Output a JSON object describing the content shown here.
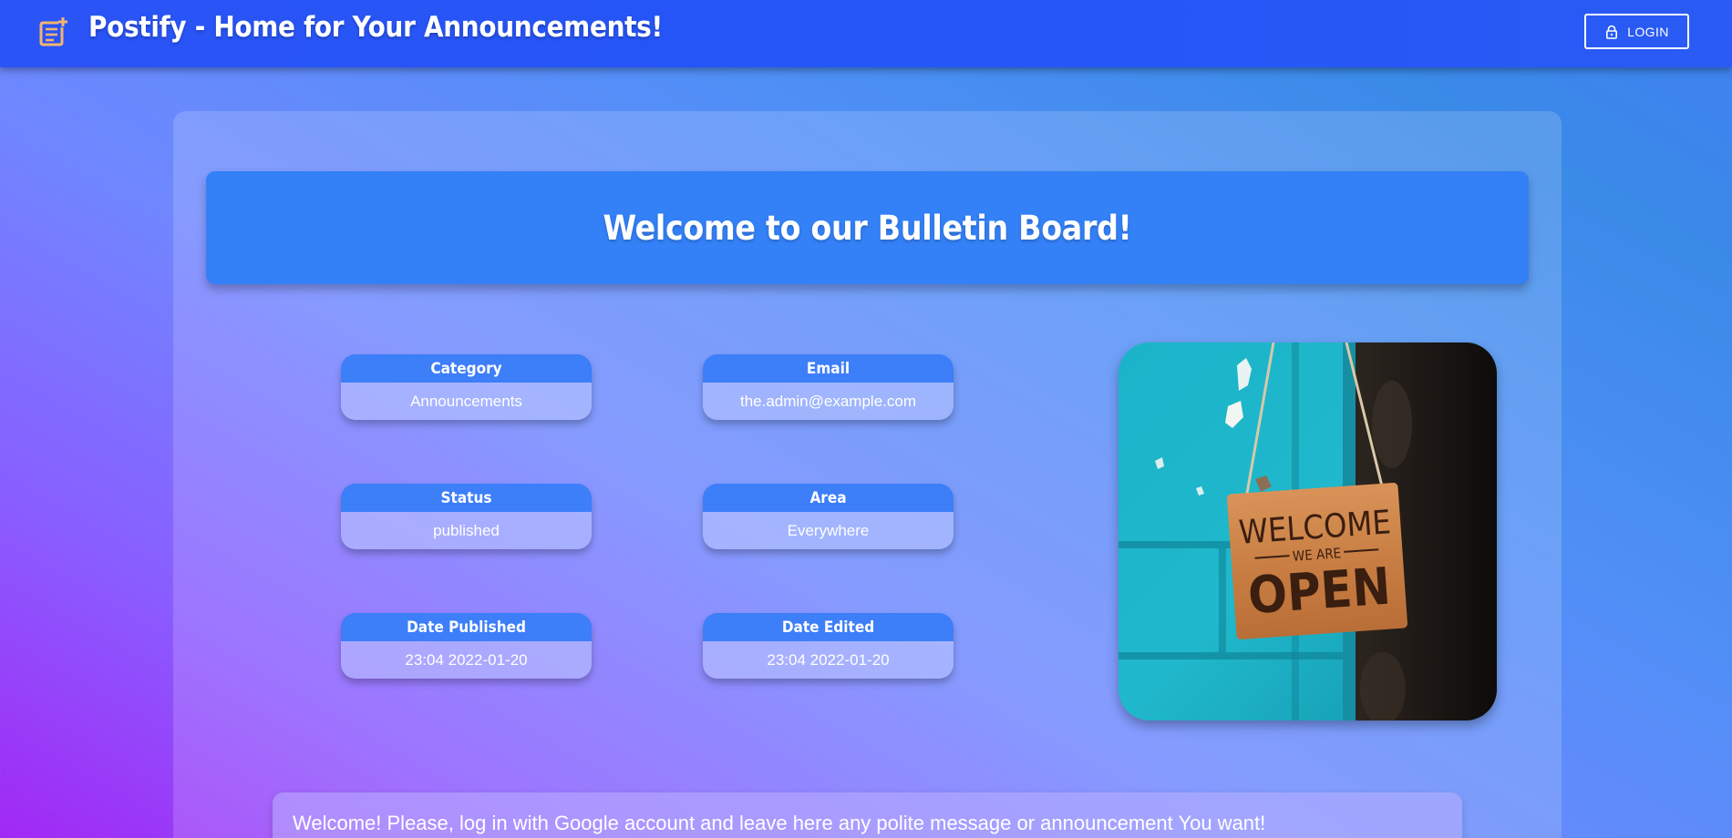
{
  "header": {
    "title": "Postify - Home for Your Announcements!",
    "icon": "post-add-icon",
    "login_label": "LOGIN",
    "login_icon": "lock-icon",
    "colors": {
      "bar": "#2456f8",
      "brand_icon": "#f3b370"
    }
  },
  "main": {
    "banner_title": "Welcome to our Bulletin Board!",
    "fields": [
      {
        "label": "Category",
        "value": "Announcements"
      },
      {
        "label": "Email",
        "value": "the.admin@example.com"
      },
      {
        "label": "Status",
        "value": "published"
      },
      {
        "label": "Area",
        "value": "Everywhere"
      },
      {
        "label": "Date Published",
        "value": "23:04 2022-01-20"
      },
      {
        "label": "Date Edited",
        "value": "23:04 2022-01-20"
      }
    ],
    "image": {
      "sign_line1": "WELCOME",
      "sign_line2": "WE ARE",
      "sign_line3": "OPEN"
    },
    "message": "Welcome! Please, log in with Google account and leave here any polite message or announcement You want!"
  }
}
